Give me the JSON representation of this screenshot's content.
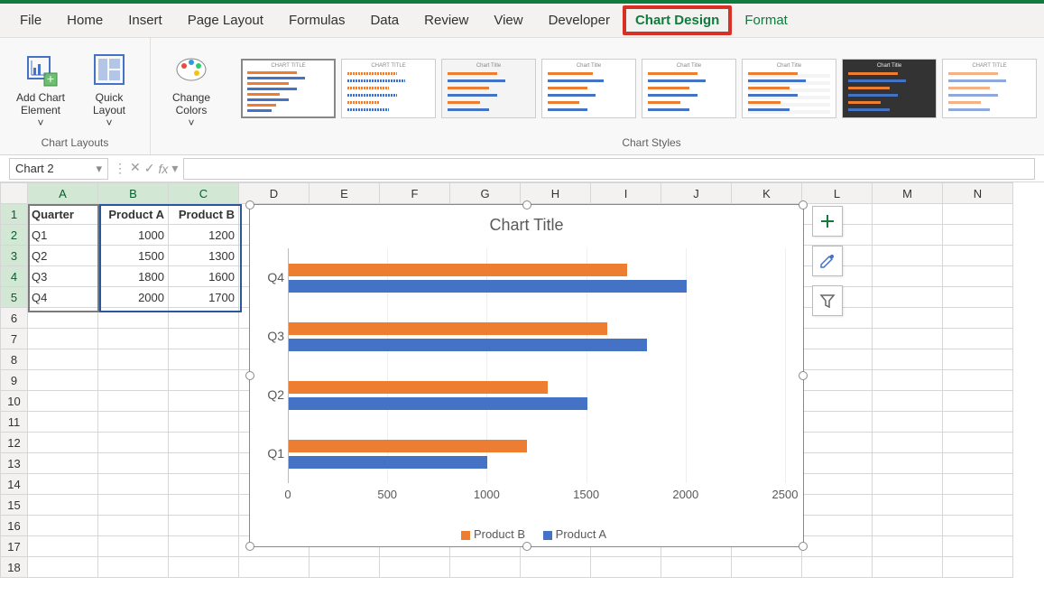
{
  "tabs": [
    "File",
    "Home",
    "Insert",
    "Page Layout",
    "Formulas",
    "Data",
    "Review",
    "View",
    "Developer",
    "Chart Design",
    "Format"
  ],
  "active_tab": "Chart Design",
  "ribbon": {
    "add_chart_element": "Add Chart\nElement",
    "quick_layout": "Quick\nLayout",
    "change_colors": "Change\nColors",
    "group_layouts": "Chart Layouts",
    "group_styles": "Chart Styles",
    "style_title": "CHART TITLE",
    "style_title_alt": "Chart Title"
  },
  "namebox": "Chart 2",
  "formula": "",
  "columns": [
    "A",
    "B",
    "C",
    "D",
    "E",
    "F",
    "G",
    "H",
    "I",
    "J",
    "K",
    "L",
    "M",
    "N"
  ],
  "rows": 18,
  "table": {
    "headers": [
      "Quarter",
      "Product A",
      "Product B"
    ],
    "data": [
      [
        "Q1",
        1000,
        1200
      ],
      [
        "Q2",
        1500,
        1300
      ],
      [
        "Q3",
        1800,
        1600
      ],
      [
        "Q4",
        2000,
        1700
      ]
    ]
  },
  "chart_data": {
    "type": "bar",
    "title": "Chart Title",
    "categories": [
      "Q1",
      "Q2",
      "Q3",
      "Q4"
    ],
    "series": [
      {
        "name": "Product A",
        "color": "#4472c4",
        "values": [
          1000,
          1500,
          1800,
          2000
        ]
      },
      {
        "name": "Product B",
        "color": "#ed7d31",
        "values": [
          1200,
          1300,
          1600,
          1700
        ]
      }
    ],
    "xlim": [
      0,
      2500
    ],
    "xticks": [
      0,
      500,
      1000,
      1500,
      2000,
      2500
    ],
    "legend": [
      "Product B",
      "Product A"
    ]
  },
  "colors": {
    "orange": "#ed7d31",
    "blue": "#4472c4",
    "green": "#0f7b3c"
  }
}
